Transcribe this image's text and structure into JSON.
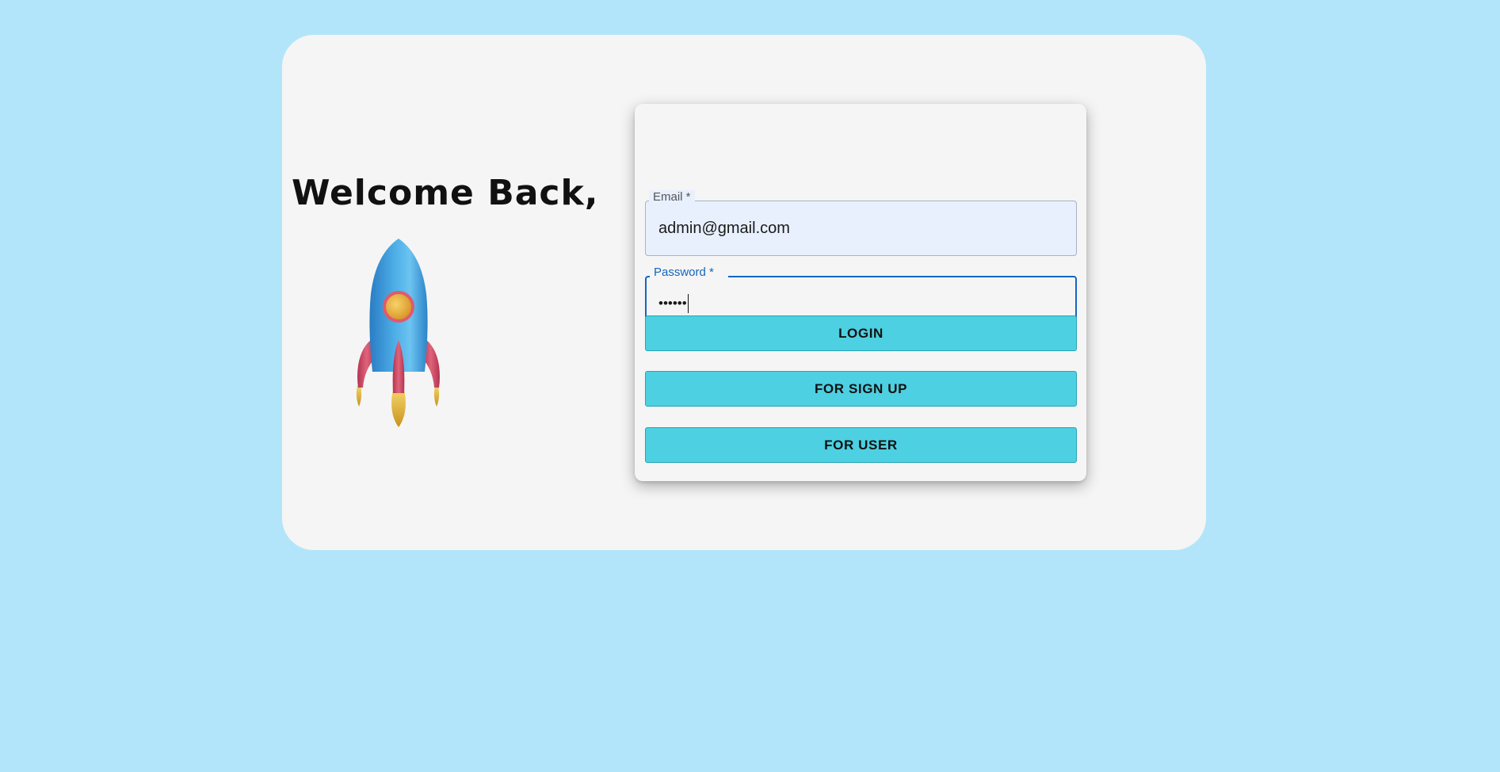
{
  "welcome": {
    "heading": "Welcome Back,",
    "image_icon": "rocket-icon"
  },
  "form": {
    "email": {
      "label": "Email *",
      "value": "admin@gmail.com"
    },
    "password": {
      "label": "Password *",
      "value": "••••••"
    },
    "buttons": {
      "login": "LOGIN",
      "signup": "FOR SIGN UP",
      "user": "FOR USER"
    }
  },
  "colors": {
    "page_background": "#b3e5fa",
    "card_background": "#f5f5f5",
    "button": "#4dd0e1",
    "focus": "#1565c0",
    "autofill": "#e8f0fe"
  }
}
